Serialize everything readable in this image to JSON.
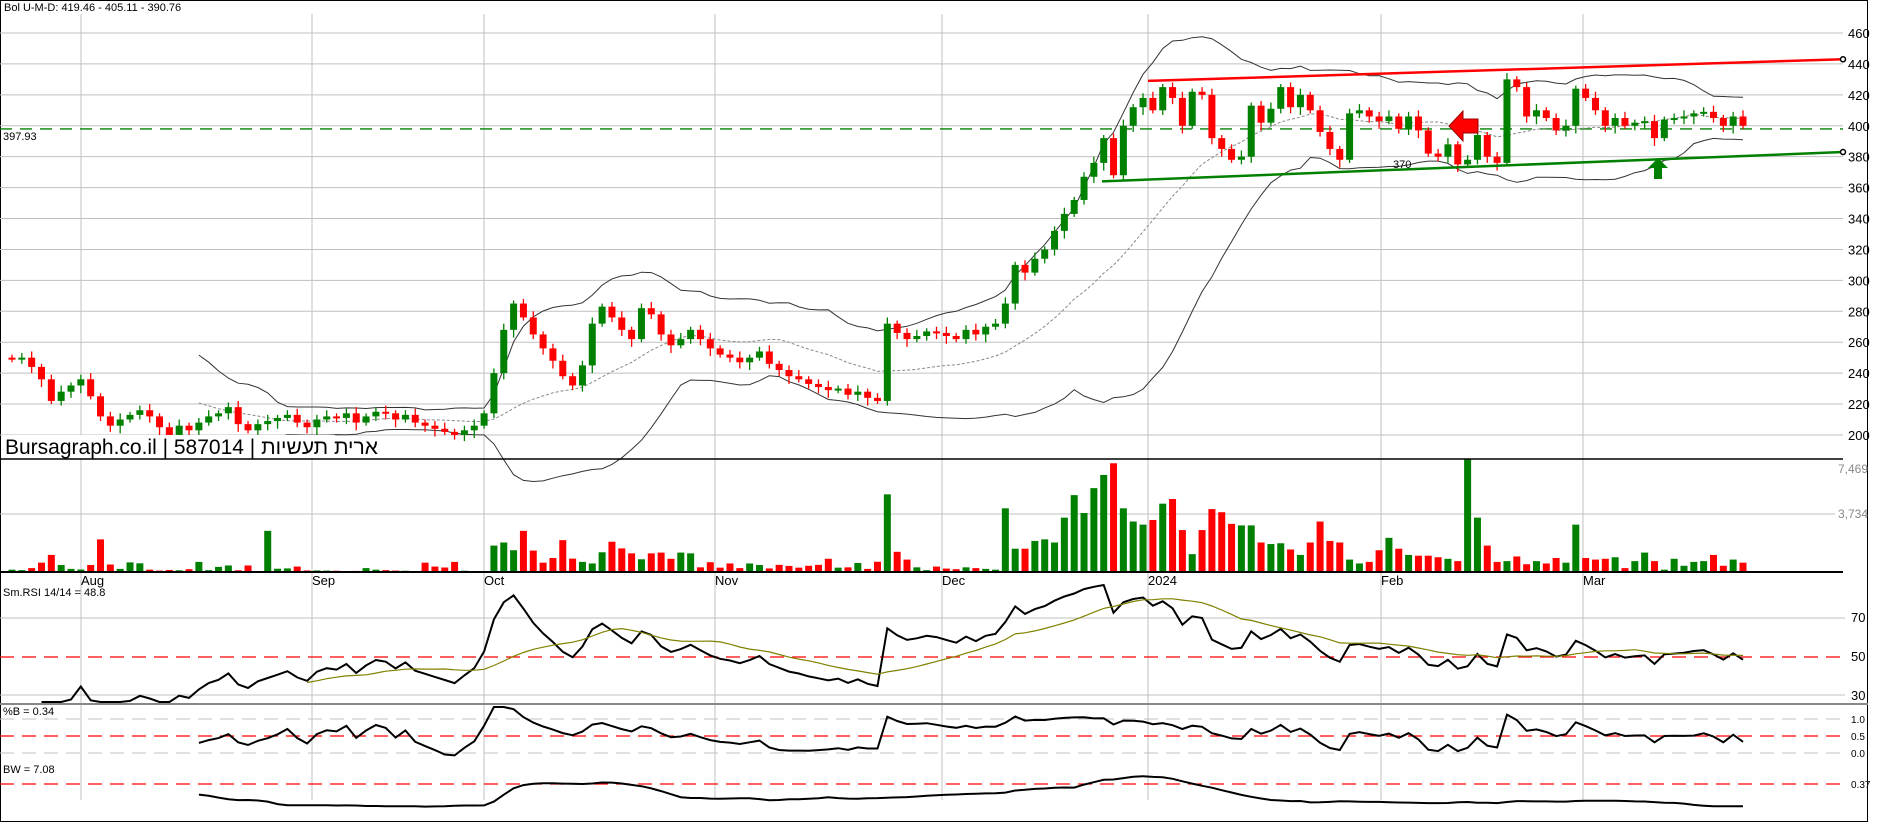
{
  "header": {
    "bollinger_label": "Bol U-M-D: 419.46 - 405.11 - 390.76",
    "support_level_label": "397.93",
    "watermark": "Bursagraph.co.il | 587014 | ארית תעשיות",
    "annotation_370": "370"
  },
  "colors": {
    "up": "#008000",
    "down": "#ff0000",
    "band": "#333333",
    "rsi_signal": "#808000"
  },
  "chart_data": {
    "type": "candlestick",
    "title": "Bol U-M-D: 419.46 - 405.11 - 390.76",
    "price_axis": {
      "ticks": [
        "460",
        "440",
        "420",
        "400",
        "380",
        "360",
        "340",
        "320",
        "300",
        "280",
        "260",
        "240",
        "220",
        "200"
      ],
      "ylim": [
        190,
        470
      ]
    },
    "month_labels": [
      "Aug",
      "Sep",
      "Oct",
      "Nov",
      "Dec",
      "2024",
      "Feb",
      "Mar"
    ],
    "horizontal_level": 397.93,
    "trendlines": [
      {
        "name": "resistance",
        "color": "#ff0000",
        "from_value": 429,
        "to_value": 443
      },
      {
        "name": "support",
        "color": "#008000",
        "from_value": 364,
        "to_value": 383
      }
    ],
    "close": [
      249,
      250,
      244,
      236,
      222,
      228,
      232,
      236,
      225,
      212,
      206,
      210,
      213,
      216,
      212,
      205,
      200,
      206,
      203,
      208,
      212,
      214,
      218,
      207,
      203,
      207,
      209,
      211,
      213,
      208,
      205,
      210,
      212,
      211,
      214,
      208,
      212,
      215,
      214,
      210,
      213,
      208,
      206,
      204,
      202,
      200,
      203,
      206,
      214,
      240,
      268,
      285,
      276,
      265,
      256,
      248,
      238,
      232,
      245,
      272,
      283,
      276,
      268,
      262,
      282,
      278,
      265,
      258,
      262,
      268,
      262,
      256,
      252,
      250,
      247,
      250,
      254,
      246,
      242,
      238,
      236,
      233,
      231,
      229,
      230,
      226,
      228,
      224,
      222,
      272,
      266,
      262,
      264,
      267,
      266,
      264,
      262,
      268,
      265,
      270,
      272,
      285,
      310,
      305,
      314,
      320,
      332,
      343,
      352,
      367,
      376,
      392,
      368,
      400,
      412,
      418,
      410,
      425,
      418,
      400,
      422,
      420,
      392,
      385,
      378,
      380,
      413,
      402,
      411,
      425,
      412,
      420,
      410,
      396,
      385,
      378,
      408,
      410,
      406,
      403,
      406,
      398,
      406,
      397,
      382,
      380,
      388,
      375,
      378,
      394,
      380,
      376,
      430,
      425,
      406,
      410,
      405,
      397,
      400,
      424,
      418,
      410,
      400,
      405,
      400,
      402,
      403,
      392,
      404,
      405,
      406,
      408,
      409,
      405,
      400,
      406,
      400
    ],
    "volume_axis": {
      "ticks": [
        "7,469",
        "3,734"
      ],
      "max": 7469
    },
    "volume": [
      150,
      120,
      250,
      600,
      1100,
      450,
      200,
      160,
      450,
      2100,
      480,
      200,
      620,
      560,
      150,
      90,
      130,
      110,
      180,
      650,
      120,
      330,
      420,
      110,
      420,
      60,
      2650,
      210,
      230,
      350,
      100,
      100,
      90,
      80,
      60,
      70,
      250,
      150,
      120,
      90,
      80,
      60,
      600,
      350,
      290,
      650,
      80,
      50,
      60,
      1700,
      1900,
      1400,
      2650,
      1380,
      600,
      900,
      2050,
      860,
      650,
      550,
      1270,
      1950,
      1520,
      1200,
      820,
      1200,
      1250,
      850,
      1250,
      1200,
      300,
      630,
      280,
      550,
      250,
      550,
      450,
      230,
      460,
      390,
      280,
      400,
      460,
      850,
      280,
      300,
      580,
      200,
      660,
      5000,
      1300,
      800,
      300,
      120,
      350,
      220,
      180,
      300,
      250,
      200,
      150,
      4100,
      1500,
      1500,
      2000,
      2100,
      1900,
      3500,
      4950,
      3800,
      5400,
      6250,
      7000,
      4100,
      3250,
      3050,
      3350,
      4400,
      4700,
      2700,
      1150,
      2700,
      4050,
      3850,
      3100,
      3000,
      3000,
      1900,
      1800,
      1850,
      1450,
      1100,
      1900,
      3250,
      2000,
      1900,
      800,
      550,
      650,
      1400,
      2200,
      1500,
      1100,
      1050,
      1050,
      950,
      850,
      700,
      7450,
      3500,
      1700,
      650,
      700,
      1000,
      500,
      700,
      550,
      900,
      600,
      3050,
      900,
      800,
      850,
      950,
      250,
      700,
      1250,
      700,
      150,
      850,
      400,
      650,
      700,
      1100,
      400,
      800,
      600
    ],
    "rsi": {
      "label": "Sm.RSI 14/14 = 48.8",
      "ticks": [
        "70",
        "50",
        "30"
      ],
      "ylim": [
        30,
        90
      ]
    },
    "percent_b": {
      "label": "%B = 0.34",
      "ticks": [
        "1.0",
        "0.5",
        "0.0"
      ]
    },
    "bandwidth": {
      "label": "BW = 7.08",
      "ticks": [
        "0.37"
      ]
    }
  }
}
